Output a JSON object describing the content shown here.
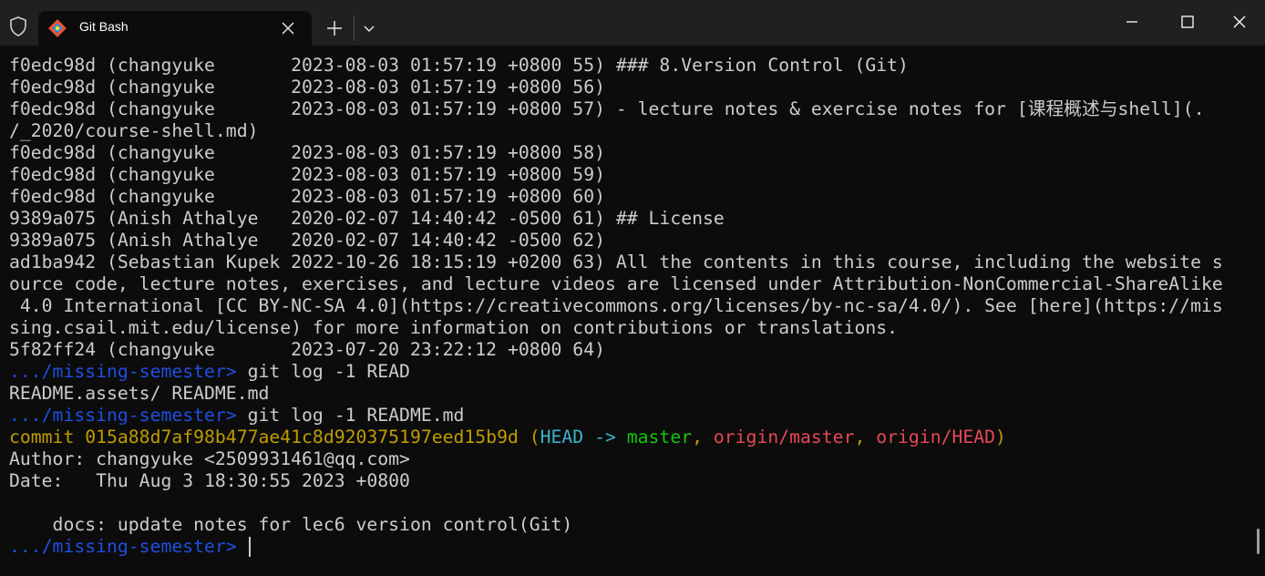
{
  "titlebar": {
    "tab_title": "Git Bash",
    "icons": [
      "shield-icon",
      "git-bash-icon",
      "close-icon",
      "plus-icon",
      "chevron-down-icon",
      "minimize-icon",
      "maximize-icon",
      "window-close-icon"
    ]
  },
  "colors": {
    "background": "#0c0c0c",
    "titlebar": "#202020",
    "text": "#cccccc",
    "prompt_blue": "#1f4fe0",
    "commit_yellow": "#c19c00",
    "head_cyan": "#3ab5c9",
    "branch_green": "#16c60c",
    "remote_red": "#e74856"
  },
  "terminal": {
    "blame_lines": [
      "f0edc98d (changyuke       2023-08-03 01:57:19 +0800 55) ### 8.Version Control (Git)",
      "f0edc98d (changyuke       2023-08-03 01:57:19 +0800 56)",
      "f0edc98d (changyuke       2023-08-03 01:57:19 +0800 57) - lecture notes & exercise notes for [课程概述与shell](.",
      "/_2020/course-shell.md)",
      "f0edc98d (changyuke       2023-08-03 01:57:19 +0800 58)",
      "f0edc98d (changyuke       2023-08-03 01:57:19 +0800 59)",
      "f0edc98d (changyuke       2023-08-03 01:57:19 +0800 60)",
      "9389a075 (Anish Athalye   2020-02-07 14:40:42 -0500 61) ## License",
      "9389a075 (Anish Athalye   2020-02-07 14:40:42 -0500 62)",
      "ad1ba942 (Sebastian Kupek 2022-10-26 18:15:19 +0200 63) All the contents in this course, including the website s",
      "ource code, lecture notes, exercises, and lecture videos are licensed under Attribution-NonCommercial-ShareAlike",
      " 4.0 International [CC BY-NC-SA 4.0](https://creativecommons.org/licenses/by-nc-sa/4.0/). See [here](https://mis",
      "sing.csail.mit.edu/license) for more information on contributions or translations.",
      "5f82ff24 (changyuke       2023-07-20 23:22:12 +0800 64)"
    ],
    "prompt_path": ".../missing-semester>",
    "cmd1": " git log -1 READ",
    "completion": "README.assets/ README.md",
    "cmd2": " git log -1 README.md",
    "commit": {
      "label": "commit 015a88d7af98b477ae41c8d920375197eed15b9d",
      "open_paren": " (",
      "head": "HEAD ->",
      "space": " ",
      "branch": "master",
      "comma1": ", ",
      "remote_master": "origin/master",
      "comma2": ", ",
      "remote_head": "origin/HEAD",
      "close_paren": ")"
    },
    "author_line": "Author: changyuke <2509931461@qq.com>",
    "date_line": "Date:   Thu Aug 3 18:30:55 2023 +0800",
    "blank_line": "",
    "message_line": "    docs: update notes for lec6 version control(Git)",
    "prompt_trail": " "
  }
}
